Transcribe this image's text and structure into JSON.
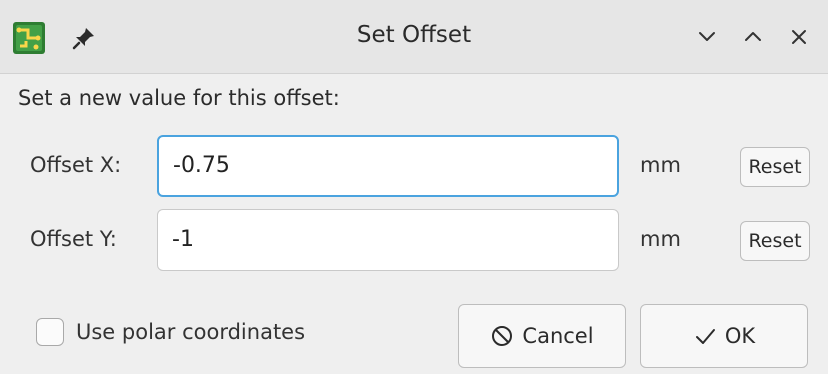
{
  "window": {
    "title": "Set Offset",
    "icons": [
      "kicad-pcb-icon",
      "pin-icon",
      "minimize-icon",
      "maximize-icon",
      "close-icon"
    ]
  },
  "prompt": "Set a new value for this offset:",
  "offset_x": {
    "label": "Offset X:",
    "value": "-0.75",
    "unit": "mm",
    "reset": "Reset"
  },
  "offset_y": {
    "label": "Offset Y:",
    "value": "-1",
    "unit": "mm",
    "reset": "Reset"
  },
  "polar": {
    "label": "Use polar coordinates",
    "checked": false
  },
  "buttons": {
    "cancel": "Cancel",
    "ok": "OK"
  },
  "colors": {
    "focus": "#4aa3df",
    "background": "#efefef"
  }
}
